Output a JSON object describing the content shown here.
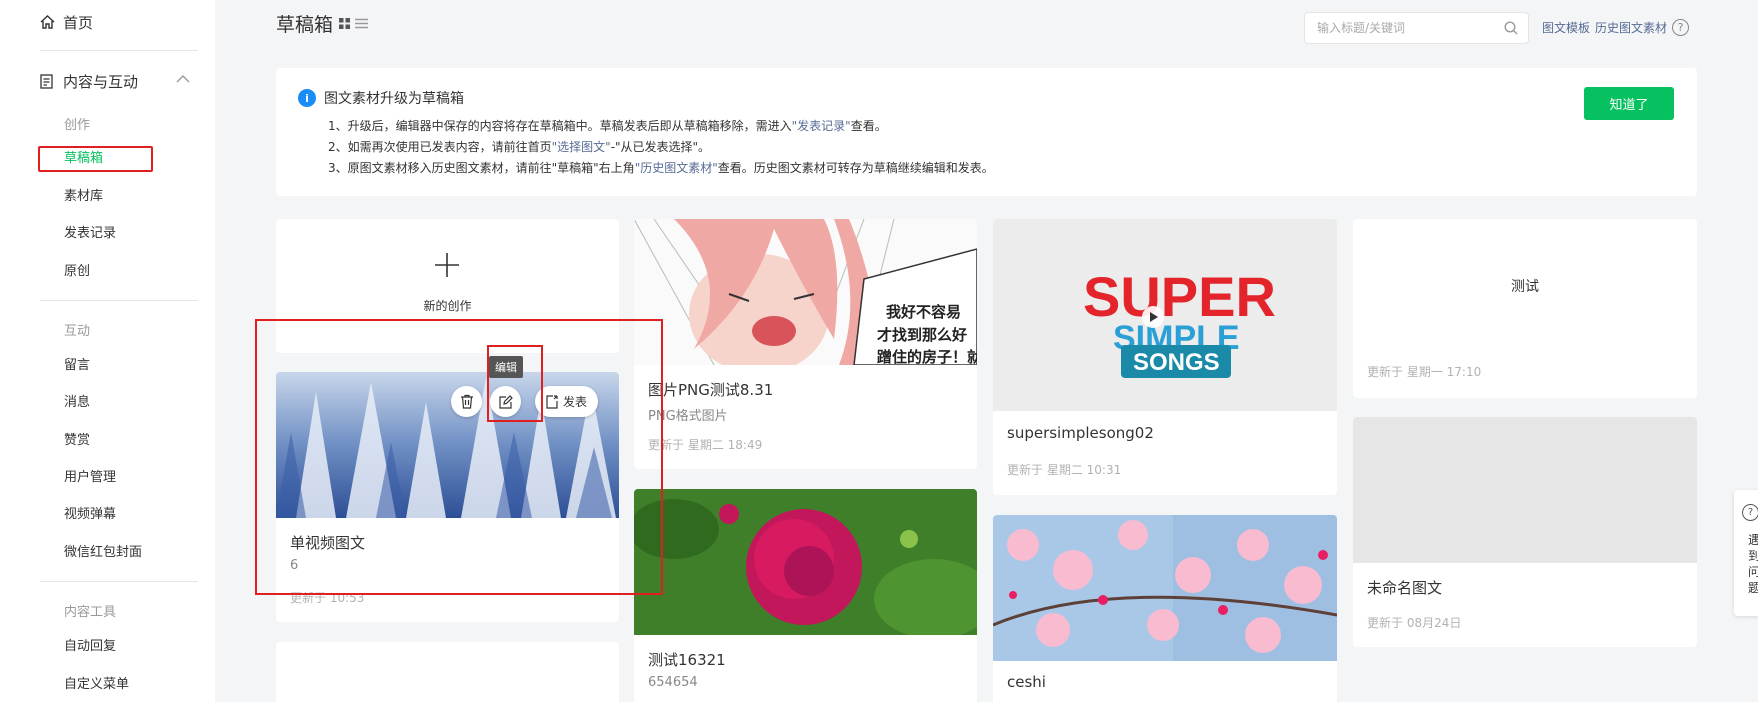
{
  "sidebar": {
    "home": "首页",
    "section": "内容与互动",
    "groups": [
      "创作",
      "互动",
      "内容工具"
    ],
    "items": {
      "drafts": "草稿箱",
      "materials": "素材库",
      "published": "发表记录",
      "original": "原创",
      "comments": "留言",
      "messages": "消息",
      "reward": "赞赏",
      "users": "用户管理",
      "danmaku": "视频弹幕",
      "redpacket": "微信红包封面",
      "autoreply": "自动回复",
      "menu": "自定义菜单"
    }
  },
  "header": {
    "title": "草稿箱",
    "search_placeholder": "输入标题/关键词",
    "links": [
      "图文模板",
      "历史图文素材"
    ],
    "help": "?"
  },
  "notice": {
    "title": "图文素材升级为草稿箱",
    "info": "i",
    "lines": [
      [
        "1、升级后，编辑器中保存的内容将存在草稿箱中。草稿发表后即从草稿箱移除，需进入",
        "\"发表记录\"",
        "查看。"
      ],
      [
        "2、如需再次使用已发表内容，请前往首页",
        "\"选择图文\"",
        "-\"从已发表选择\"。"
      ],
      [
        "3、原图文素材移入历史图文素材，请前往\"草稿箱\"右上角",
        "\"历史图文素材\"",
        "查看。历史图文素材可转存为草稿继续编辑和发表。"
      ]
    ],
    "button": "知道了"
  },
  "new_card": {
    "label": "新的创作"
  },
  "card_actions": {
    "publish": "发表",
    "tooltip": "编辑"
  },
  "cards": {
    "video_draft": {
      "title": "单视频图文",
      "sub": "6",
      "date": "更新于 10:53"
    },
    "png_test": {
      "title": "图片PNG测试8.31",
      "sub": "PNG格式图片",
      "date": "更新于 星期二 18:49",
      "comic_text": [
        "我好不容易",
        "才找到那么好",
        "蹭住的房子！就"
      ]
    },
    "song": {
      "title": "supersimplesong02",
      "date": "更新于 星期二 10:31",
      "logo": [
        "SUPER",
        "SIMPLE",
        "SONGS"
      ]
    },
    "test_card": {
      "title": "测试",
      "date": "更新于 星期一 17:10"
    },
    "peony": {
      "title": "测试16321",
      "sub": "654654"
    },
    "blossom": {
      "title": "ceshi"
    },
    "untitled": {
      "title": "未命名图文",
      "date": "更新于 08月24日"
    }
  },
  "float_help": {
    "icon": "?",
    "text": "遇到问题"
  },
  "colors": {
    "accent": "#07c160",
    "link": "#576b95",
    "highlight": "#e02020",
    "info": "#1a8cf5"
  }
}
